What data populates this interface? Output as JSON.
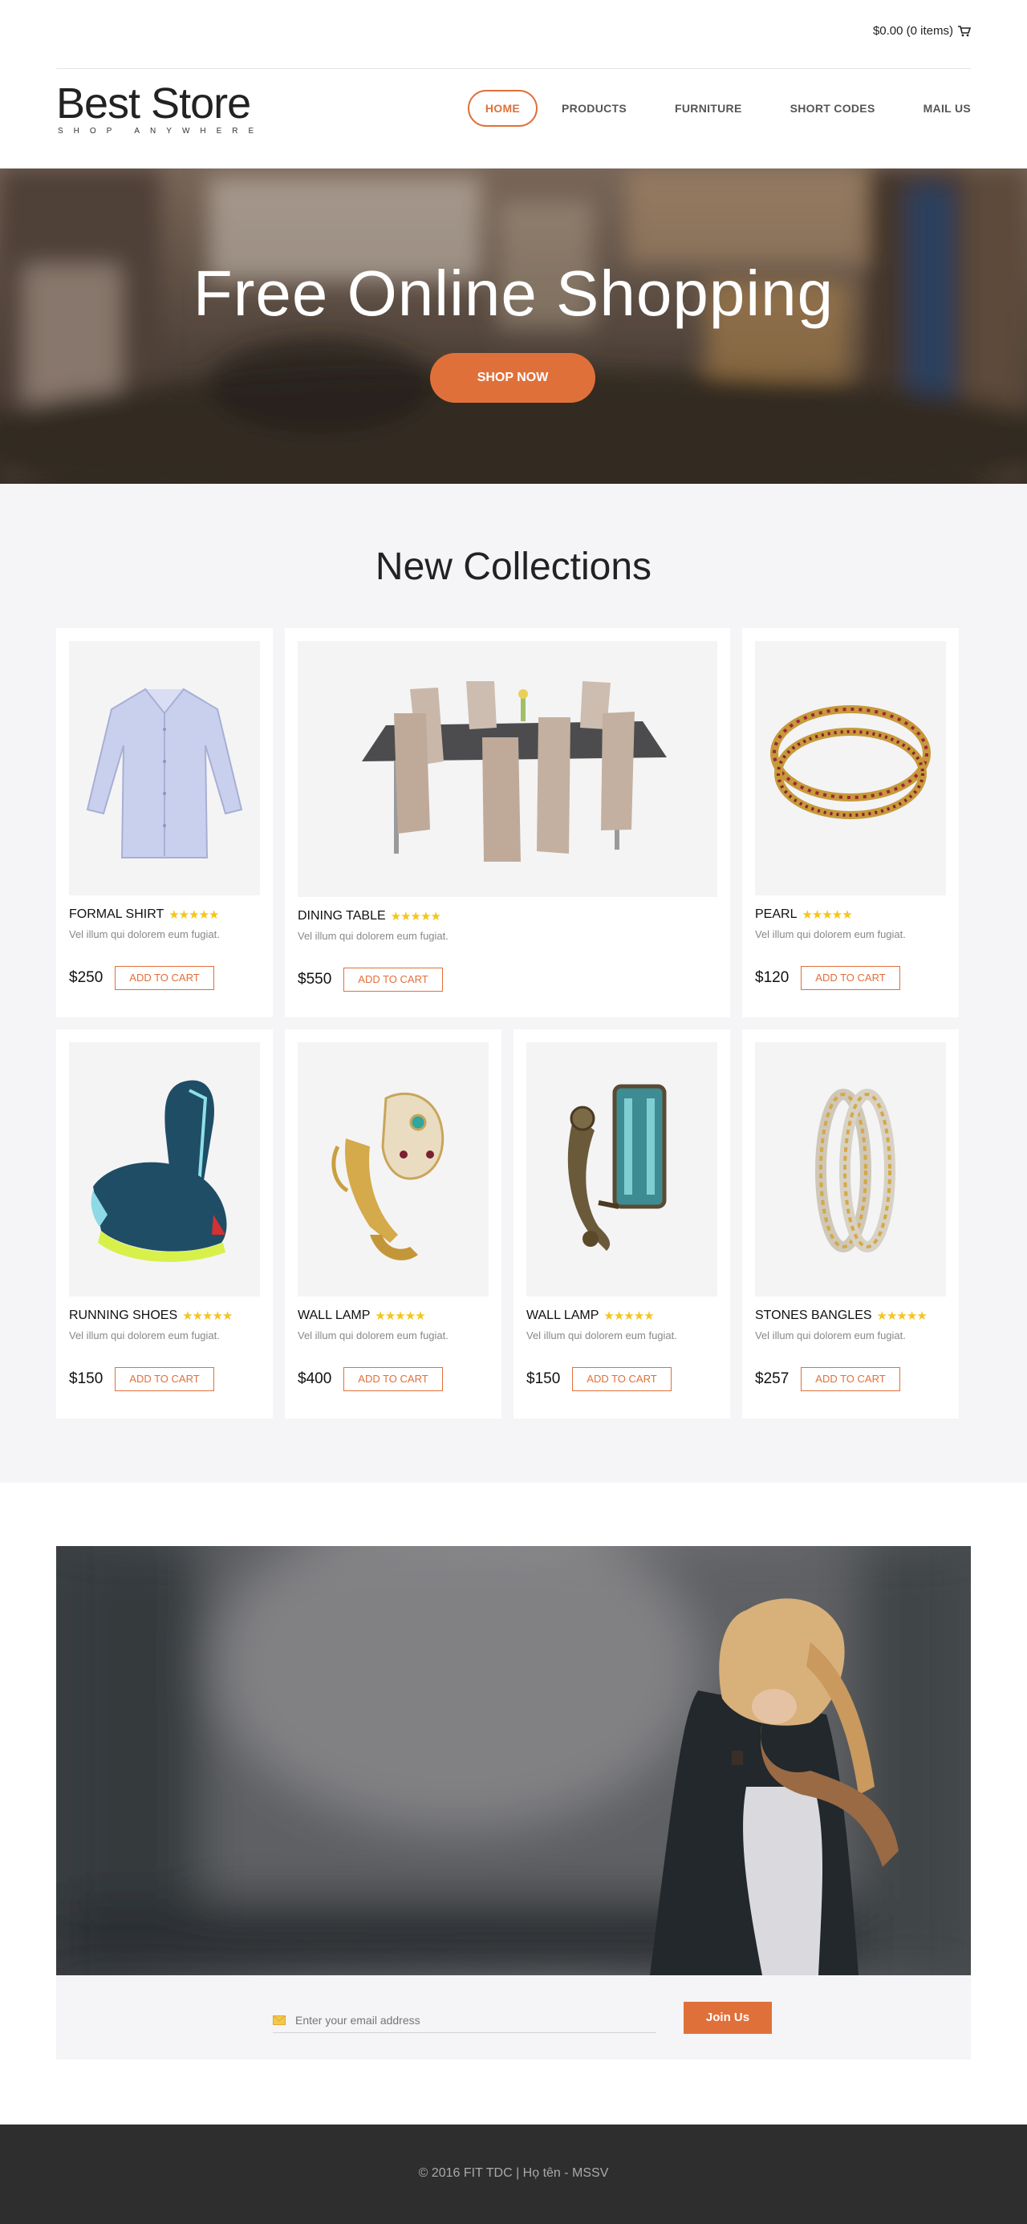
{
  "header": {
    "cart_text": "$0.00 (0 items)",
    "logo_title": "Best Store",
    "logo_tagline": "SHOP ANYWHERE",
    "nav": [
      {
        "label": "HOME",
        "active": true
      },
      {
        "label": "PRODUCTS"
      },
      {
        "label": "FURNITURE"
      },
      {
        "label": "SHORT CODES"
      },
      {
        "label": "MAIL US"
      }
    ]
  },
  "hero": {
    "title": "Free Online Shopping",
    "button": "SHOP NOW"
  },
  "collections": {
    "title": "New Collections",
    "products": [
      {
        "name": "FORMAL SHIRT",
        "desc": "Vel illum qui dolorem eum fugiat.",
        "price": "$250",
        "cta": "ADD TO CART",
        "rating": 5
      },
      {
        "name": "DINING TABLE",
        "desc": "Vel illum qui dolorem eum fugiat.",
        "price": "$550",
        "cta": "ADD TO CART",
        "rating": 5
      },
      {
        "name": "PEARL",
        "desc": "Vel illum qui dolorem eum fugiat.",
        "price": "$120",
        "cta": "ADD TO CART",
        "rating": 5
      },
      {
        "name": "RUNNING SHOES",
        "desc": "Vel illum qui dolorem eum fugiat.",
        "price": "$150",
        "cta": "ADD TO CART",
        "rating": 5
      },
      {
        "name": "WALL LAMP",
        "desc": "Vel illum qui dolorem eum fugiat.",
        "price": "$400",
        "cta": "ADD TO CART",
        "rating": 5
      },
      {
        "name": "WALL LAMP",
        "desc": "Vel illum qui dolorem eum fugiat.",
        "price": "$150",
        "cta": "ADD TO CART",
        "rating": 5
      },
      {
        "name": "STONES BANGLES",
        "desc": "Vel illum qui dolorem eum fugiat.",
        "price": "$257",
        "cta": "ADD TO CART",
        "rating": 5
      }
    ]
  },
  "newsletter": {
    "placeholder": "Enter your email address",
    "button": "Join Us"
  },
  "footer": {
    "text": "© 2016 FIT TDC | Họ tên - MSSV"
  },
  "colors": {
    "accent": "#e0703a",
    "star": "#f5c518",
    "footer_bg": "#2e2e2e"
  }
}
